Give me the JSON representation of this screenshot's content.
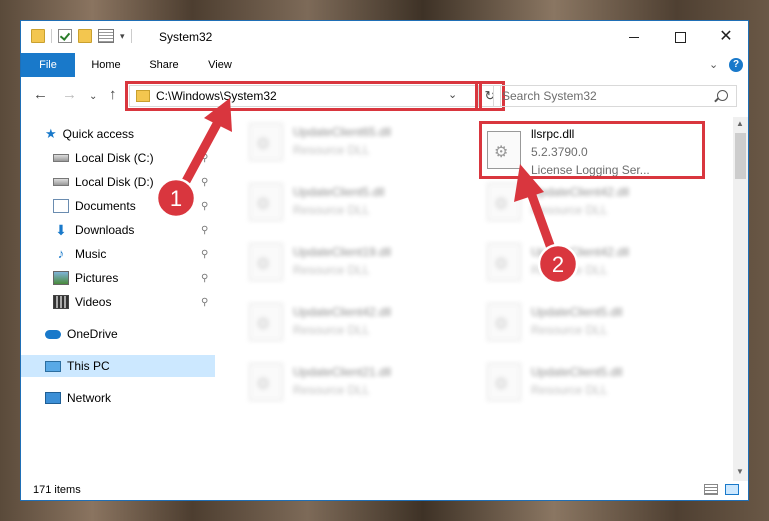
{
  "window": {
    "title": "System32",
    "minimize_icon": "minimize-icon",
    "maximize_icon": "maximize-icon",
    "close_glyph": "✕"
  },
  "ribbon": {
    "tabs": [
      "File",
      "Home",
      "Share",
      "View"
    ],
    "chevron": "⌄",
    "help": "?"
  },
  "navbar": {
    "back": "←",
    "forward": "→",
    "history": "⌄",
    "up": "↑",
    "address": "C:\\Windows\\System32",
    "address_dropdown": "⌄",
    "refresh": "↻",
    "search_placeholder": "Search System32"
  },
  "nav_pane": {
    "items": [
      {
        "label": "Quick access",
        "icon": "star-icon"
      },
      {
        "label": "Local Disk (C:)",
        "icon": "drive-icon",
        "pinned": true
      },
      {
        "label": "Local Disk (D:)",
        "icon": "drive-icon",
        "pinned": true
      },
      {
        "label": "Documents",
        "icon": "documents-icon",
        "pinned": true
      },
      {
        "label": "Downloads",
        "icon": "download-icon",
        "pinned": true
      },
      {
        "label": "Music",
        "icon": "music-icon",
        "pinned": true
      },
      {
        "label": "Pictures",
        "icon": "pictures-icon",
        "pinned": true
      },
      {
        "label": "Videos",
        "icon": "videos-icon",
        "pinned": true
      },
      {
        "label": "OneDrive",
        "icon": "cloud-icon"
      },
      {
        "label": "This PC",
        "icon": "computer-icon",
        "selected": true
      },
      {
        "label": "Network",
        "icon": "network-icon"
      }
    ],
    "pin_glyph": "📌"
  },
  "files": {
    "selected": {
      "name": "llsrpc.dll",
      "version": "5.2.3790.0",
      "type": "License Logging Ser..."
    },
    "left_column": [
      {
        "name": "UpdateClient65.dll",
        "type": "Resource DLL"
      },
      {
        "name": "UpdateClient5.dll",
        "type": "Resource DLL"
      },
      {
        "name": "UpdateClient19.dll",
        "type": "Resource DLL"
      },
      {
        "name": "UpdateClient42.dll",
        "type": "Resource DLL"
      },
      {
        "name": "UpdateClient21.dll",
        "type": "Resource DLL"
      }
    ],
    "right_column": [
      {
        "name": "UpdateClient42.dll",
        "type": "Resource DLL"
      },
      {
        "name": "UpdateClient42.dll",
        "type": "Resource DLL"
      },
      {
        "name": "UpdateClient5.dll",
        "type": "Resource DLL"
      },
      {
        "name": "UpdateClient5.dll",
        "type": "Resource DLL"
      }
    ]
  },
  "status": {
    "item_count": "171 items"
  },
  "annotations": {
    "step1": "1",
    "step2": "2",
    "color": "#d9363e"
  },
  "scrollbar": {
    "up": "▲",
    "down": "▼"
  }
}
